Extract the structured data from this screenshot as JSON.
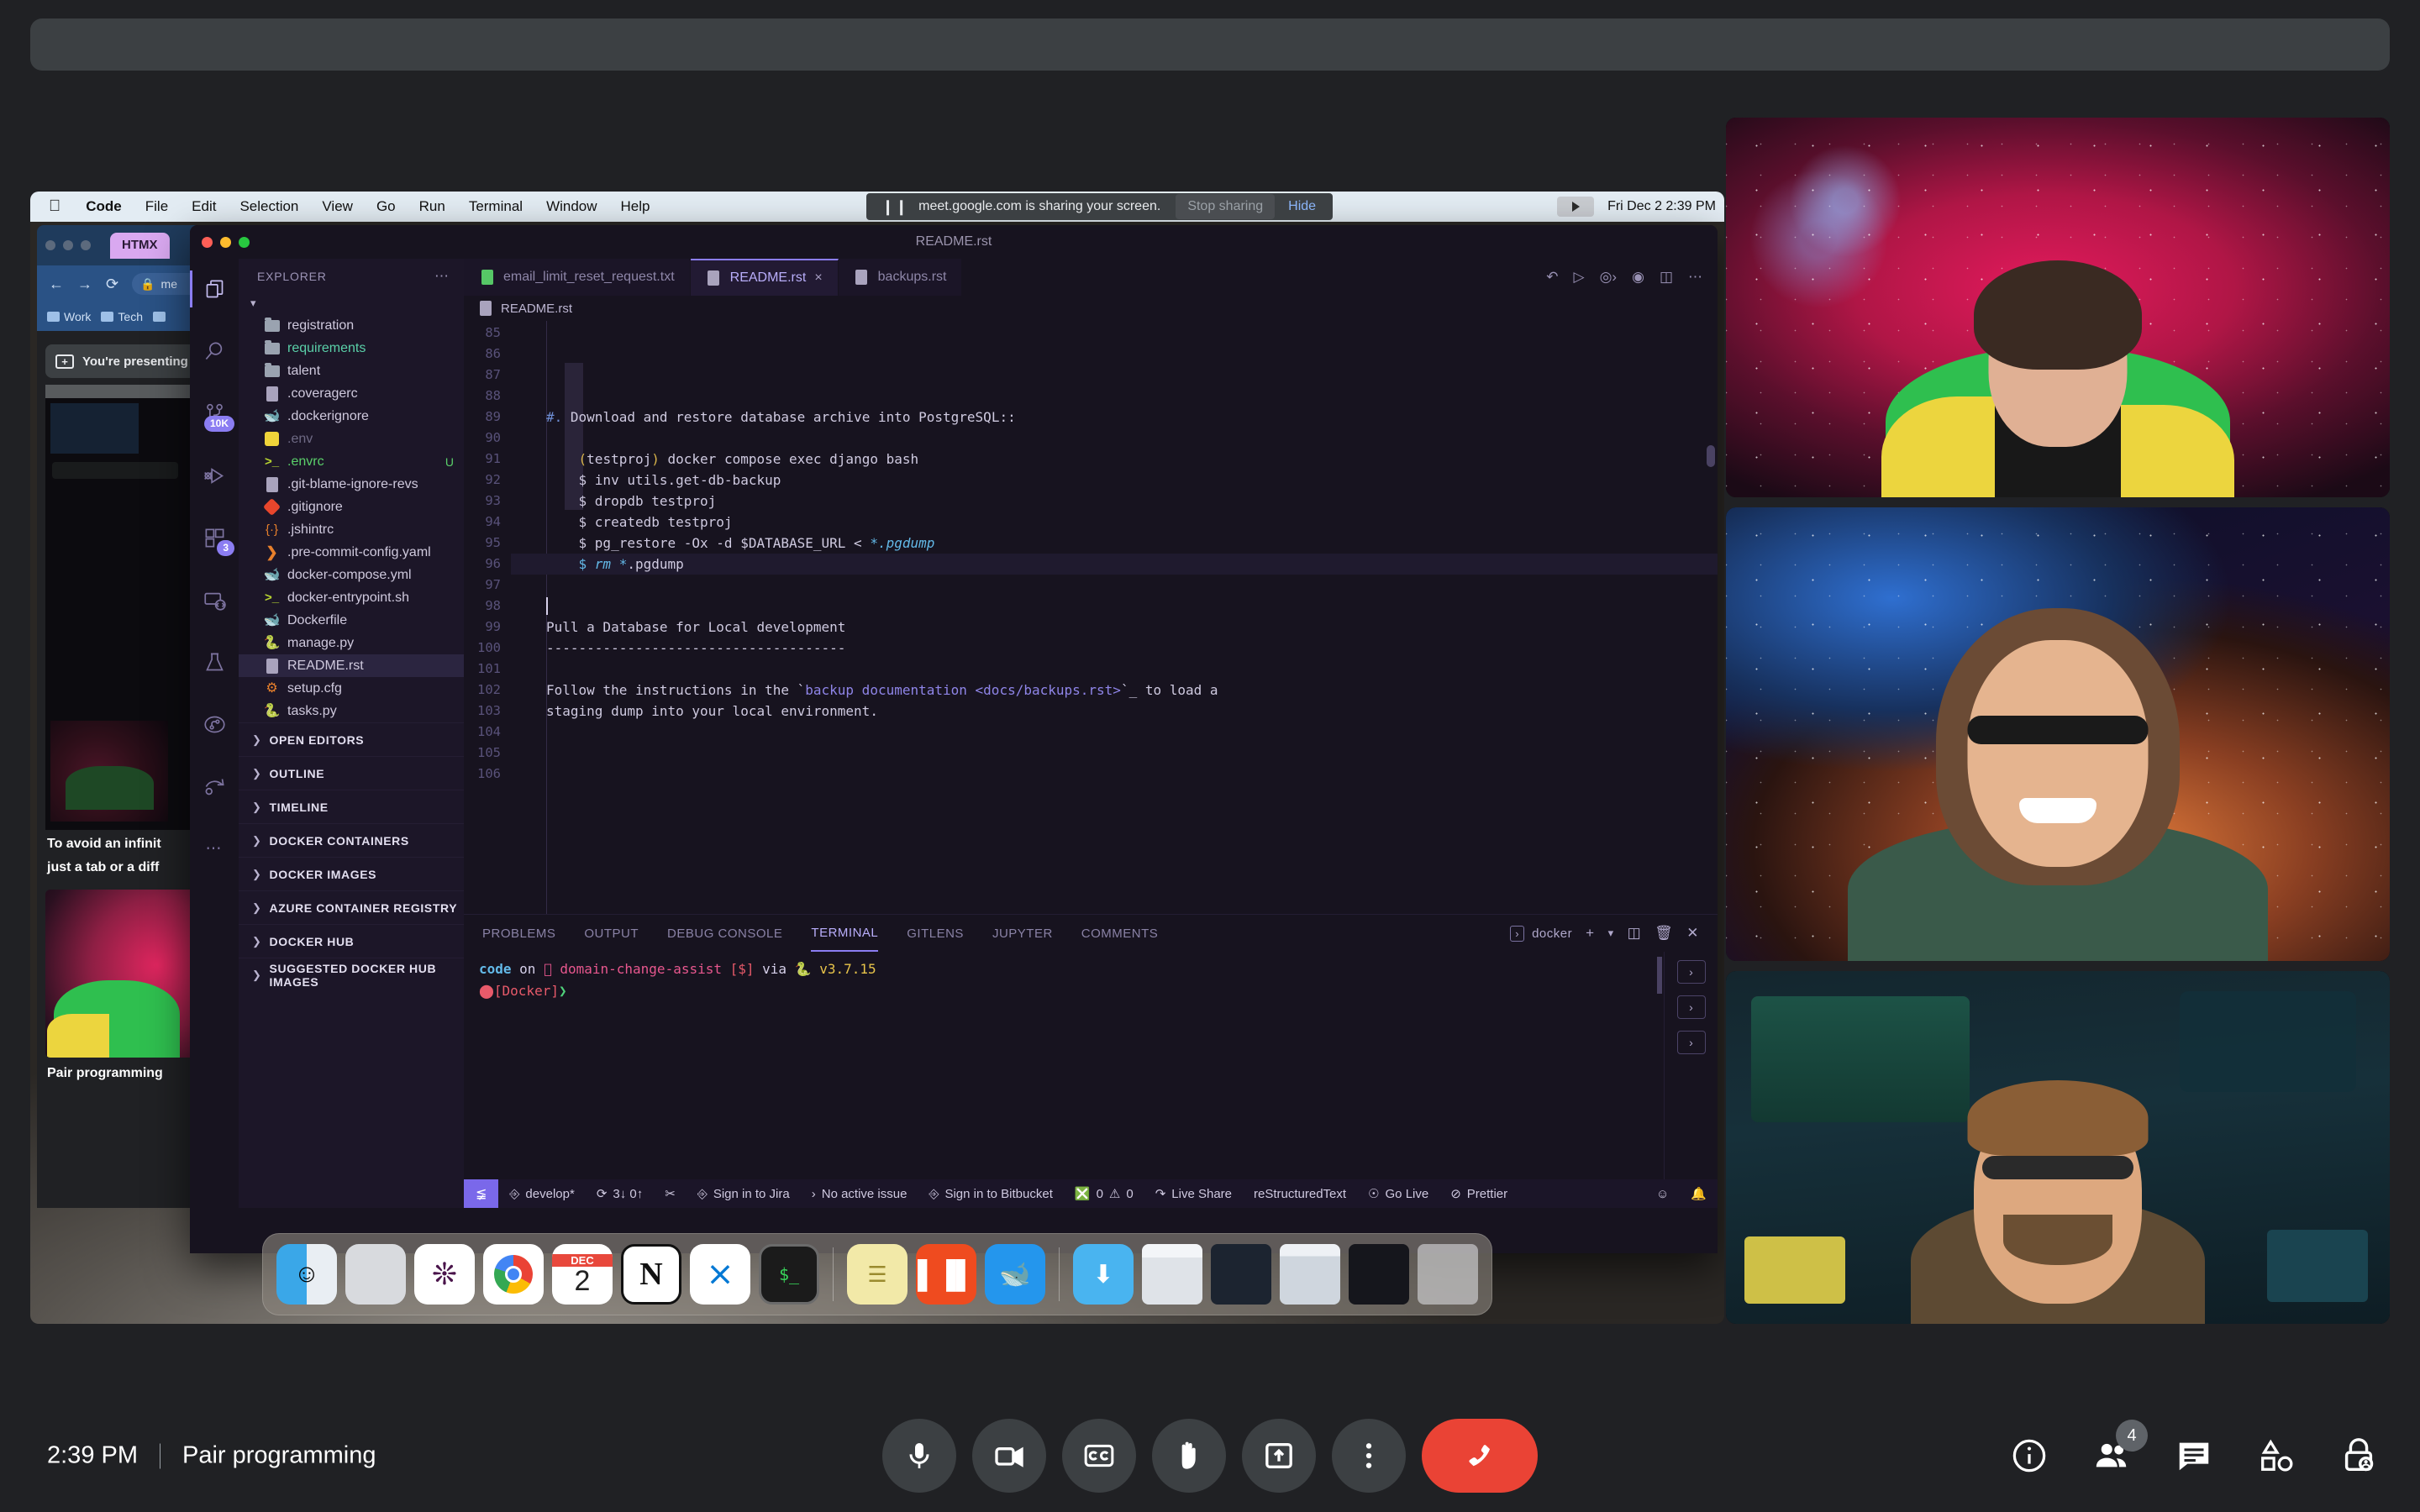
{
  "meet": {
    "time": "2:39 PM",
    "meeting_title": "Pair programming",
    "separator": "|",
    "controls": [
      {
        "name": "microphone",
        "label": "Turn off microphone"
      },
      {
        "name": "camera",
        "label": "Turn off camera"
      },
      {
        "name": "captions",
        "label": "Turn on captions"
      },
      {
        "name": "raise-hand",
        "label": "Raise hand"
      },
      {
        "name": "present-now",
        "label": "Present now"
      },
      {
        "name": "more-options",
        "label": "More options"
      },
      {
        "name": "leave-call",
        "label": "Leave call"
      }
    ],
    "right_controls": [
      {
        "name": "meeting-details",
        "label": "Meeting details"
      },
      {
        "name": "participants",
        "label": "Show everyone",
        "count": "4"
      },
      {
        "name": "chat",
        "label": "Chat with everyone"
      },
      {
        "name": "activities",
        "label": "Activities"
      },
      {
        "name": "host-controls",
        "label": "Host controls"
      }
    ]
  },
  "share_notice": {
    "message": "meet.google.com is sharing your screen.",
    "stop_label": "Stop sharing",
    "hide_label": "Hide"
  },
  "macos": {
    "menubar": [
      "Code",
      "File",
      "Edit",
      "Selection",
      "View",
      "Go",
      "Run",
      "Terminal",
      "Window",
      "Help"
    ],
    "clock": "Fri Dec 2  2:39 PM",
    "dock": [
      {
        "name": "finder",
        "label": "Finder"
      },
      {
        "name": "launchpad",
        "label": "Launchpad"
      },
      {
        "name": "slack",
        "label": "Slack"
      },
      {
        "name": "chrome",
        "label": "Google Chrome"
      },
      {
        "name": "calendar",
        "label": "Calendar",
        "month": "DEC",
        "day": "2"
      },
      {
        "name": "notion",
        "label": "Notion"
      },
      {
        "name": "vscode",
        "label": "Visual Studio Code"
      },
      {
        "name": "terminal",
        "label": "Terminal"
      },
      {
        "name": "stickies",
        "label": "Stickies"
      },
      {
        "name": "audio-app",
        "label": "Audio Hijack"
      },
      {
        "name": "docker",
        "label": "Docker"
      }
    ]
  },
  "bg_window": {
    "tab_label": "HTMX",
    "bookmarks": [
      "Work",
      "Tech"
    ],
    "presenting_label": "You're presenting",
    "caption_line1": "To avoid an infinit",
    "caption_line2": "just a tab or a diff",
    "self_name": "Pair programming"
  },
  "vscode": {
    "window_title": "README.rst",
    "activity_bar": [
      {
        "name": "explorer",
        "badge": ""
      },
      {
        "name": "search",
        "badge": ""
      },
      {
        "name": "source-control",
        "badge": "10K"
      },
      {
        "name": "run-and-debug",
        "badge": ""
      },
      {
        "name": "extensions",
        "badge": "3"
      },
      {
        "name": "remote-explorer",
        "badge": ""
      },
      {
        "name": "testing",
        "badge": ""
      },
      {
        "name": "git-graph",
        "badge": ""
      },
      {
        "name": "live-share",
        "badge": ""
      },
      {
        "name": "more-views",
        "badge": ""
      }
    ],
    "explorer_title": "EXPLORER",
    "files": [
      {
        "name": "registration",
        "type": "folder",
        "status": "",
        "state": ""
      },
      {
        "name": "requirements",
        "type": "folder",
        "status": "",
        "state": "modified"
      },
      {
        "name": "talent",
        "type": "folder",
        "status": "",
        "state": ""
      },
      {
        "name": ".coveragerc",
        "type": "doc",
        "status": "",
        "state": ""
      },
      {
        "name": ".dockerignore",
        "type": "docker",
        "status": "",
        "state": ""
      },
      {
        "name": ".env",
        "type": "env",
        "status": "",
        "state": "ignored"
      },
      {
        "name": ".envrc",
        "type": "shell",
        "status": "U",
        "state": "untracked"
      },
      {
        "name": ".git-blame-ignore-revs",
        "type": "doc",
        "status": "",
        "state": ""
      },
      {
        "name": ".gitignore",
        "type": "git",
        "status": "",
        "state": ""
      },
      {
        "name": ".jshintrc",
        "type": "json",
        "status": "",
        "state": ""
      },
      {
        "name": ".pre-commit-config.yaml",
        "type": "yaml",
        "status": "",
        "state": ""
      },
      {
        "name": "docker-compose.yml",
        "type": "docker",
        "status": "",
        "state": ""
      },
      {
        "name": "docker-entrypoint.sh",
        "type": "shell",
        "status": "",
        "state": ""
      },
      {
        "name": "Dockerfile",
        "type": "docker",
        "status": "",
        "state": ""
      },
      {
        "name": "manage.py",
        "type": "python",
        "status": "",
        "state": ""
      },
      {
        "name": "README.rst",
        "type": "doc",
        "status": "",
        "state": "selected"
      },
      {
        "name": "setup.cfg",
        "type": "gear",
        "status": "",
        "state": ""
      },
      {
        "name": "tasks.py",
        "type": "python",
        "status": "",
        "state": ""
      }
    ],
    "sections": [
      "OPEN EDITORS",
      "OUTLINE",
      "TIMELINE",
      "DOCKER CONTAINERS",
      "DOCKER IMAGES",
      "AZURE CONTAINER REGISTRY",
      "DOCKER HUB",
      "SUGGESTED DOCKER HUB IMAGES"
    ],
    "tabs": [
      {
        "label": "email_limit_reset_request.txt",
        "active": false,
        "close": ""
      },
      {
        "label": "README.rst",
        "active": true,
        "close": "×"
      },
      {
        "label": "backups.rst",
        "active": false,
        "close": ""
      }
    ],
    "breadcrumb": "README.rst",
    "code": {
      "first_line_number": 85,
      "lines": [
        {
          "n": "85",
          "segments": [
            {
              "t": "#. ",
              "c": "tk-dir"
            },
            {
              "t": "Download and restore database archive into PostgreSQL::",
              "c": "tk-lit"
            }
          ]
        },
        {
          "n": "86",
          "segments": []
        },
        {
          "n": "87",
          "segments": [
            {
              "t": "    ",
              "c": "tk-lit"
            },
            {
              "t": "(",
              "c": "tk-par"
            },
            {
              "t": "testproj",
              "c": "tk-lit"
            },
            {
              "t": ")",
              "c": "tk-par"
            },
            {
              "t": " docker compose exec django bash",
              "c": "tk-lit"
            }
          ]
        },
        {
          "n": "88",
          "segments": [
            {
              "t": "    $ inv utils.get-db-backup",
              "c": "tk-lit"
            }
          ]
        },
        {
          "n": "89",
          "segments": [
            {
              "t": "    $ dropdb testproj",
              "c": "tk-lit"
            }
          ]
        },
        {
          "n": "90",
          "segments": [
            {
              "t": "    $ createdb testproj",
              "c": "tk-lit"
            }
          ]
        },
        {
          "n": "91",
          "segments": [
            {
              "t": "    $ pg_restore -Ox -d $DATABASE_URL < ",
              "c": "tk-lit"
            },
            {
              "t": "*",
              "c": "tk-key"
            },
            {
              "t": ".pgdump",
              "c": "tk-em"
            }
          ]
        },
        {
          "n": "92",
          "segments": [
            {
              "t": "    ",
              "c": "tk-lit"
            },
            {
              "t": "$ ",
              "c": "tk-key"
            },
            {
              "t": "rm ",
              "c": "tk-em"
            },
            {
              "t": "*",
              "c": "tk-key"
            },
            {
              "t": ".pgdump",
              "c": "tk-lit"
            }
          ]
        },
        {
          "n": "93",
          "segments": []
        },
        {
          "n": "94",
          "segments": []
        },
        {
          "n": "95",
          "segments": [
            {
              "t": "Pull a Database for Local development",
              "c": "tk-lit"
            }
          ]
        },
        {
          "n": "96",
          "segments": [
            {
              "t": "-------------------------------------",
              "c": "tk-lit"
            }
          ]
        },
        {
          "n": "97",
          "segments": []
        },
        {
          "n": "98",
          "segments": [
            {
              "t": "Follow the instructions in the `",
              "c": "tk-lit"
            },
            {
              "t": "backup documentation <docs/backups.rst>",
              "c": "tk-str"
            },
            {
              "t": "`_ to load a",
              "c": "tk-lit"
            }
          ]
        },
        {
          "n": "99",
          "segments": [
            {
              "t": "staging dump into your local environment.",
              "c": "tk-lit"
            }
          ]
        },
        {
          "n": "100",
          "segments": []
        },
        {
          "n": "101",
          "segments": []
        },
        {
          "n": "102",
          "segments": []
        },
        {
          "n": "103",
          "segments": []
        },
        {
          "n": "104",
          "segments": []
        },
        {
          "n": "105",
          "segments": []
        },
        {
          "n": "106",
          "segments": []
        }
      ]
    },
    "panel": {
      "tabs": [
        "PROBLEMS",
        "OUTPUT",
        "DEBUG CONSOLE",
        "TERMINAL",
        "GITLENS",
        "JUPYTER",
        "COMMENTS"
      ],
      "active_tab": "TERMINAL",
      "shell_label": "docker",
      "terminal": {
        "line1_part1": "code",
        "line1_part2": " on ",
        "line1_branch": " domain-change-assist",
        "line1_flags": " [$]",
        "line1_via": " via ",
        "line1_version": " v3.7.15",
        "line2_context": "[Docker]",
        "line2_prompt": "❯"
      }
    },
    "statusbar": {
      "branch": "develop*",
      "sync": "3↓ 0↑",
      "jira": "Sign in to Jira",
      "issue": "No active issue",
      "bitbucket": "Sign in to Bitbucket",
      "errors": "0",
      "warnings": "0",
      "liveshare": "Live Share",
      "language": "reStructuredText",
      "golive": "Go Live",
      "prettier": "Prettier"
    }
  }
}
